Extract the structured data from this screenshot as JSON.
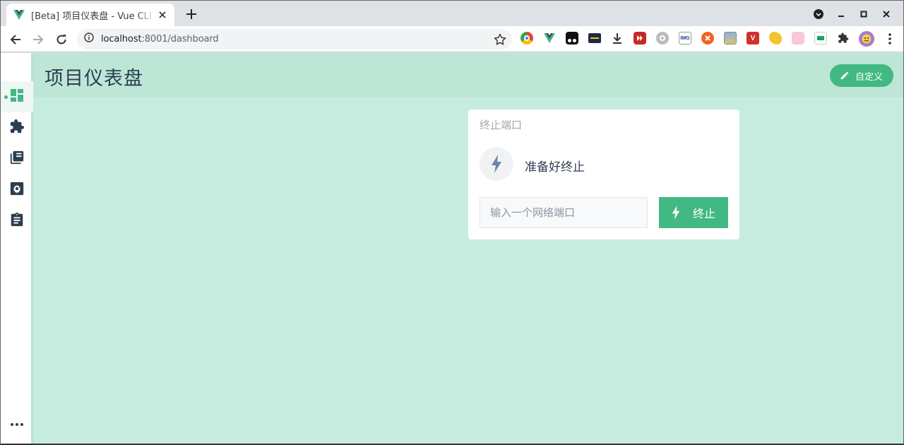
{
  "browser": {
    "tab_title": "[Beta] 项目仪表盘 - Vue CLI",
    "url_host": "localhost",
    "url_rest": ":8001/dashboard"
  },
  "sidebar": {
    "items": [
      {
        "icon": "dashboard-icon",
        "active": true
      },
      {
        "icon": "puzzle-icon"
      },
      {
        "icon": "library-icon"
      },
      {
        "icon": "settings-icon"
      },
      {
        "icon": "clipboard-icon"
      }
    ],
    "more_icon": "more-horiz-icon"
  },
  "header": {
    "title": "项目仪表盘",
    "customize_label": "自定义"
  },
  "widget": {
    "title": "终止端口",
    "status": "准备好终止",
    "input_placeholder": "输入一个网络端口",
    "kill_label": "终止"
  },
  "colors": {
    "accent": "#42b983",
    "background": "#c6ebdf",
    "header": "#bde6d6",
    "text": "#2c3e50"
  }
}
